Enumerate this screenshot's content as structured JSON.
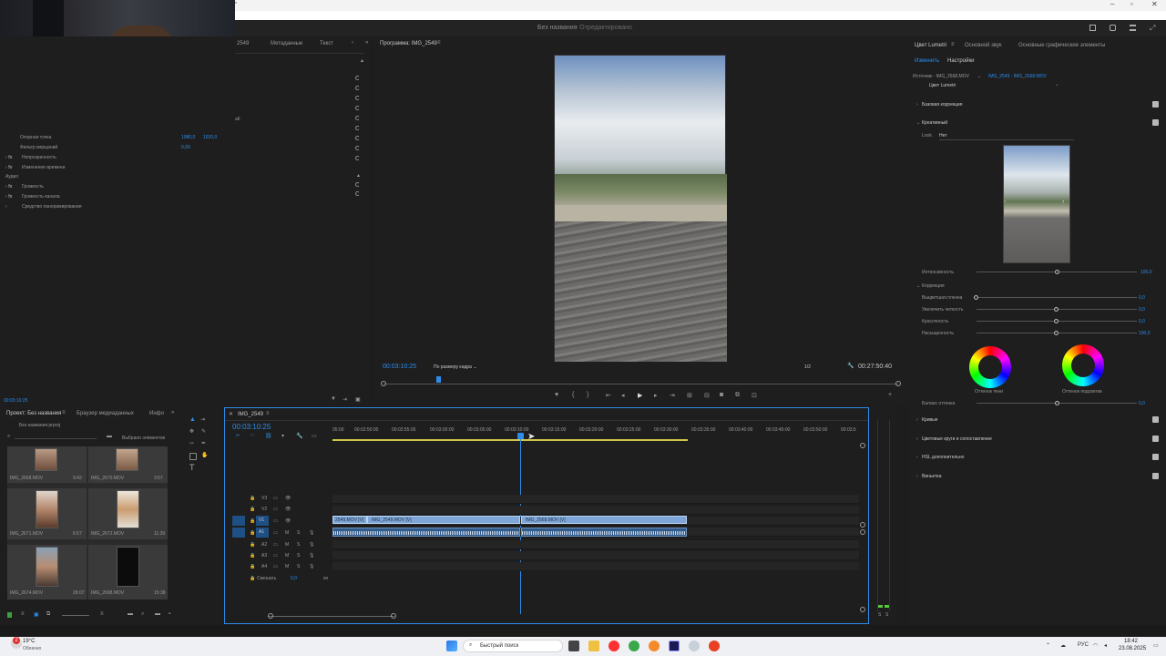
{
  "window": {
    "title": "*",
    "sequence_title": "Без названия",
    "sequence_status": "Отредактировано"
  },
  "effect_controls": {
    "tabs": [
      "2549",
      "Метаданные",
      "Текст"
    ],
    "rows": [
      {
        "label": "Опорная точка",
        "v1": "1080,0",
        "v2": "1920,0"
      },
      {
        "label": "Фильтр мерцаний",
        "v1": "0,00"
      },
      {
        "label": "Непрозрачность"
      },
      {
        "label": "Изменение времени"
      },
      {
        "label": "Аудио"
      },
      {
        "label": "Громкость"
      },
      {
        "label": "Громкость канала"
      },
      {
        "label": "Средство панорамирования"
      }
    ],
    "partial_value": "а6",
    "timecode": "00:03:10:25"
  },
  "program": {
    "title": "Программа: IMG_2549",
    "timecode": "00:03:10:25",
    "fit": "По размеру кадра",
    "ratio": "1/2",
    "duration": "00:27:50:40"
  },
  "lumetri": {
    "tabs": [
      "Цвет Lumetri",
      "Основной звук",
      "Основные графические элементы"
    ],
    "subtabs": [
      "Изменить",
      "Настройки"
    ],
    "source": "Источник - IMG_2568.MOV",
    "source_seq": "IMG_2549 - IMG_2568.MOV",
    "preset": "Цвет Lumetri",
    "sections": [
      "Базовая коррекция",
      "Креативный",
      "Кривые",
      "Цветовые круги и сопоставление",
      "HSL дополнительно",
      "Виньетка"
    ],
    "look_label": "Look",
    "look_value": "Нет",
    "intensity_label": "Интенсивность",
    "intensity_value": "100,0",
    "correction_label": "Коррекция",
    "sliders": [
      {
        "label": "Выцветшая пленка",
        "value": "0,0",
        "level": 0
      },
      {
        "label": "Увеличить четкость",
        "value": "0,0",
        "level": 0.5
      },
      {
        "label": "Красочность",
        "value": "0,0",
        "level": 0.5
      },
      {
        "label": "Насыщенность",
        "value": "100,0",
        "level": 0.5
      }
    ],
    "wheel_shadow": "Оттенок тени",
    "wheel_highlight": "Оттенок подсветки",
    "balance_label": "Баланс оттенка",
    "balance_value": "0,0"
  },
  "project": {
    "tabs": [
      "Проект: Без названия",
      "Браузер медиаданных",
      "Инфо"
    ],
    "name": "Без названия.prproj",
    "selected": "Выбрано элементов",
    "items": [
      {
        "name": "IMG_2668.MOV",
        "dur": "9:42"
      },
      {
        "name": "IMG_2670.MOV",
        "dur": "3:57"
      },
      {
        "name": "IMG_2671.MOV",
        "dur": "6:57"
      },
      {
        "name": "IMG_2672.MOV",
        "dur": "11:39"
      },
      {
        "name": "IMG_2674.MOV",
        "dur": "28:07"
      },
      {
        "name": "IMG_2698.MOV",
        "dur": "15:38"
      }
    ]
  },
  "timeline": {
    "tab": "IMG_2549",
    "timecode": "00:03:10:25",
    "ruler": [
      "05:00",
      "00:02:50:00",
      "00:02:55:00",
      "00:03:00:00",
      "00:03:05:00",
      "00:03:10:00",
      "00:03:15:00",
      "00:03:20:00",
      "00:03:25:00",
      "00:03:30:00",
      "00:03:35:00",
      "00:03:40:00",
      "00:03:45:00",
      "00:03:50:00",
      "00:03:5"
    ],
    "tracks": [
      "V3",
      "V2",
      "V1",
      "A1",
      "A2",
      "A3",
      "A4"
    ],
    "mix_label": "Смешать",
    "mix_value": "0,0",
    "clips": [
      {
        "name": "2549.MOV [V]"
      },
      {
        "name": "IMG_2549.MOV [V]"
      },
      {
        "name": "IMG_2568.MOV [V]"
      }
    ]
  },
  "taskbar": {
    "weather_temp": "19°C",
    "weather_desc": "Облачно",
    "badge": "2",
    "search": "Быстрый поиск",
    "lang": "РУС",
    "time": "18:42",
    "date": "23.08.2025"
  }
}
